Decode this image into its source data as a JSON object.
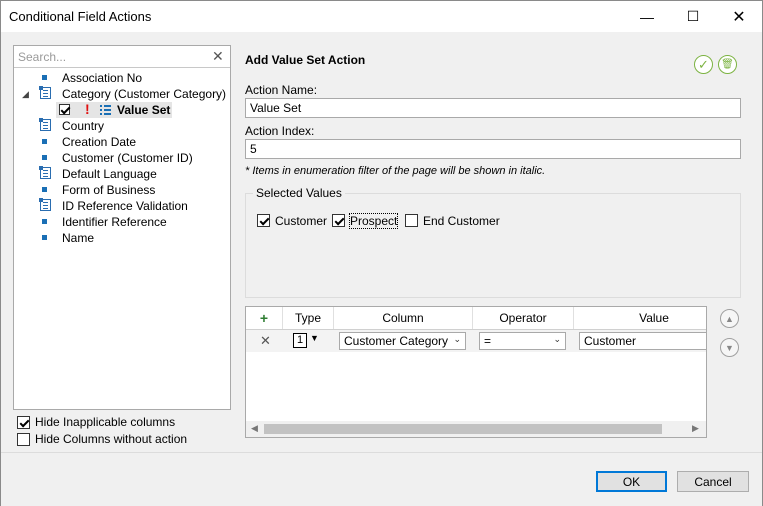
{
  "window": {
    "title": "Conditional Field Actions",
    "minimize_glyph": "—",
    "maximize_glyph": "☐",
    "close_glyph": "✕"
  },
  "search": {
    "placeholder": "Search...",
    "clear_glyph": "✕"
  },
  "tree": {
    "items": [
      {
        "label": "Association No",
        "icon": "bullet-icon"
      },
      {
        "label": "Category (Customer Category)",
        "icon": "list-field-icon",
        "expanded": true
      },
      {
        "label": "Value Set",
        "icon": "list-icon",
        "checked": true,
        "warning": "!"
      },
      {
        "label": "Country",
        "icon": "list-field-icon"
      },
      {
        "label": "Creation Date",
        "icon": "bullet-icon"
      },
      {
        "label": "Customer (Customer ID)",
        "icon": "bullet-icon"
      },
      {
        "label": "Default Language",
        "icon": "list-field-icon"
      },
      {
        "label": "Form of Business",
        "icon": "bullet-icon"
      },
      {
        "label": "ID Reference Validation",
        "icon": "list-field-icon"
      },
      {
        "label": "Identifier Reference",
        "icon": "bullet-icon"
      },
      {
        "label": "Name",
        "icon": "bullet-icon"
      }
    ]
  },
  "options": {
    "hide_inapplicable": {
      "label": "Hide Inapplicable columns",
      "checked": true
    },
    "hide_without_action": {
      "label": "Hide Columns without action",
      "checked": false
    }
  },
  "panel": {
    "title": "Add Value Set Action",
    "confirm_glyph": "✓",
    "delete_glyph": "🗑",
    "action_name_label": "Action Name:",
    "action_name_value": "Value Set",
    "action_index_label": "Action Index:",
    "action_index_value": "5",
    "note": "* Items in enumeration filter of the page will be shown in italic.",
    "selected_values_label": "Selected Values",
    "values": [
      {
        "label": "Customer",
        "checked": true
      },
      {
        "label": "Prospect",
        "checked": true
      },
      {
        "label": "End Customer",
        "checked": false
      }
    ]
  },
  "grid": {
    "add_glyph": "+",
    "headers": {
      "type": "Type",
      "column": "Column",
      "operator": "Operator",
      "value": "Value"
    },
    "rows": [
      {
        "remove_glyph": "✕",
        "type": "1",
        "column": "Customer Category",
        "operator": "=",
        "value": "Customer"
      }
    ],
    "up_glyph": "▲",
    "down_glyph": "▼",
    "scroll_left_glyph": "◀",
    "scroll_right_glyph": "▶"
  },
  "buttons": {
    "ok": "OK",
    "cancel": "Cancel"
  },
  "colors": {
    "accent_green": "#7cb342",
    "icon_blue": "#1a6fb5",
    "warning_red": "#e01010",
    "default_button_border": "#0078d7"
  }
}
